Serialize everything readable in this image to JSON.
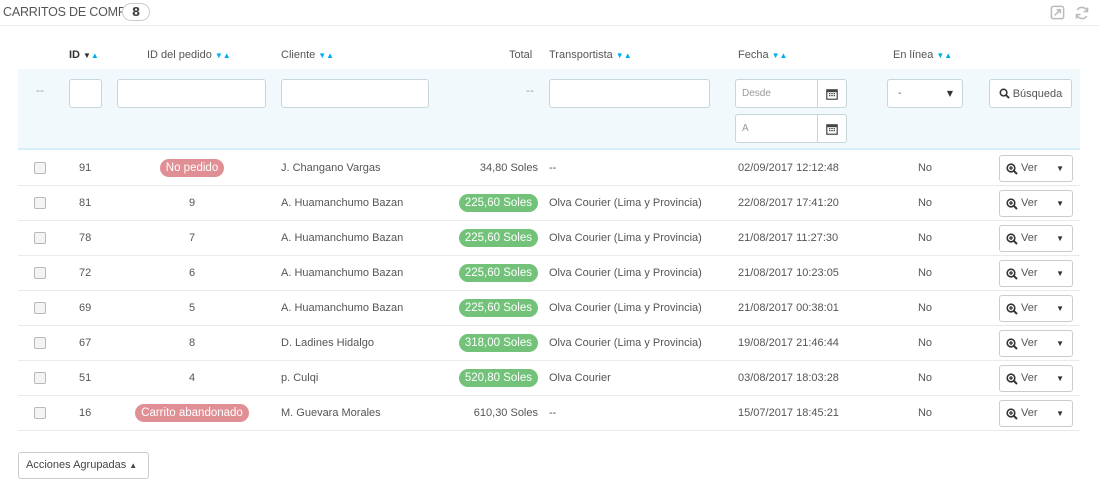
{
  "panel": {
    "title": "CARRITOS DE COMPRA",
    "count": "8"
  },
  "columns": {
    "id": "ID",
    "order_id": "ID del pedido",
    "customer": "Cliente",
    "total": "Total",
    "carrier": "Transportista",
    "date": "Fecha",
    "online": "En línea"
  },
  "filters": {
    "id_dash": "--",
    "total_dash": "--",
    "date_from_placeholder": "Desde",
    "date_to_placeholder": "A",
    "online_selected": "-",
    "search_label": "Búsqueda"
  },
  "rows": [
    {
      "id": "91",
      "order": "No pedido",
      "order_type": "badge-red",
      "customer": "J. Changano Vargas",
      "total": "34,80 Soles",
      "total_type": "plain",
      "carrier": "--",
      "date": "02/09/2017 12:12:48",
      "online": "No"
    },
    {
      "id": "81",
      "order": "9",
      "order_type": "plain",
      "customer": "A. Huamanchumo Bazan",
      "total": "225,60 Soles",
      "total_type": "badge-green",
      "carrier": "Olva Courier (Lima y Provincia)",
      "date": "22/08/2017 17:41:20",
      "online": "No"
    },
    {
      "id": "78",
      "order": "7",
      "order_type": "plain",
      "customer": "A. Huamanchumo Bazan",
      "total": "225,60 Soles",
      "total_type": "badge-green",
      "carrier": "Olva Courier (Lima y Provincia)",
      "date": "21/08/2017 11:27:30",
      "online": "No"
    },
    {
      "id": "72",
      "order": "6",
      "order_type": "plain",
      "customer": "A. Huamanchumo Bazan",
      "total": "225,60 Soles",
      "total_type": "badge-green",
      "carrier": "Olva Courier (Lima y Provincia)",
      "date": "21/08/2017 10:23:05",
      "online": "No"
    },
    {
      "id": "69",
      "order": "5",
      "order_type": "plain",
      "customer": "A. Huamanchumo Bazan",
      "total": "225,60 Soles",
      "total_type": "badge-green",
      "carrier": "Olva Courier (Lima y Provincia)",
      "date": "21/08/2017 00:38:01",
      "online": "No"
    },
    {
      "id": "67",
      "order": "8",
      "order_type": "plain",
      "customer": "D. Ladines Hidalgo",
      "total": "318,00 Soles",
      "total_type": "badge-green",
      "carrier": "Olva Courier (Lima y Provincia)",
      "date": "19/08/2017 21:46:44",
      "online": "No"
    },
    {
      "id": "51",
      "order": "4",
      "order_type": "plain",
      "customer": "p. Culqi",
      "total": "520,80 Soles",
      "total_type": "badge-green",
      "carrier": "Olva Courier",
      "date": "03/08/2017 18:03:28",
      "online": "No"
    },
    {
      "id": "16",
      "order": "Carrito abandonado",
      "order_type": "badge-red",
      "customer": "M. Guevara Morales",
      "total": "610,30 Soles",
      "total_type": "plain",
      "carrier": "--",
      "date": "15/07/2017 18:45:21",
      "online": "No"
    }
  ],
  "row_action": {
    "view_label": "Ver"
  },
  "bulk": {
    "label": "Acciones Agrupadas"
  },
  "colors": {
    "accent": "#00aff0",
    "green_badge": "#72c279",
    "red_badge": "#e08f95",
    "filter_bg": "#f1f9fd"
  },
  "icons": [
    "export-icon",
    "refresh-icon",
    "calendar-icon",
    "search-icon",
    "zoom-in-icon",
    "caret-down-icon",
    "caret-up-icon"
  ]
}
